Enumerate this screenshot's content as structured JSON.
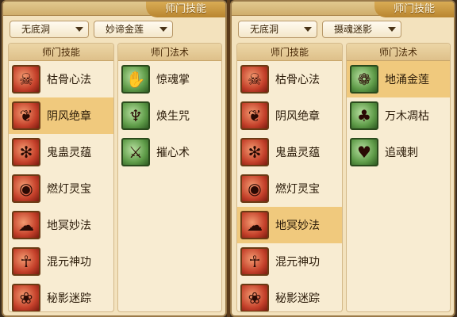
{
  "panels": [
    {
      "title": "师门技能",
      "dropdown_school": "无底洞",
      "dropdown_skill": "妙谛金莲",
      "skills_header": "师门技能",
      "spells_header": "师门法术",
      "skills": [
        {
          "label": "枯骨心法",
          "icon": "skull-meditation-icon",
          "selected": false
        },
        {
          "label": "阴风绝章",
          "icon": "wind-scroll-icon",
          "selected": true
        },
        {
          "label": "鬼蛊灵蕴",
          "icon": "demon-insect-icon",
          "selected": false
        },
        {
          "label": "燃灯灵宝",
          "icon": "lamp-coin-icon",
          "selected": false
        },
        {
          "label": "地冥妙法",
          "icon": "underworld-cloud-icon",
          "selected": false
        },
        {
          "label": "混元神功",
          "icon": "chaos-figure-icon",
          "selected": false
        },
        {
          "label": "秘影迷踪",
          "icon": "shadow-swirl-icon",
          "selected": false
        }
      ],
      "spells": [
        {
          "label": "惊魂掌",
          "icon": "palm-icon"
        },
        {
          "label": "焕生咒",
          "icon": "rebirth-figure-icon"
        },
        {
          "label": "摧心术",
          "icon": "heart-crush-icon"
        }
      ]
    },
    {
      "title": "师门技能",
      "dropdown_school": "无底洞",
      "dropdown_skill": "摄魂迷影",
      "skills_header": "师门技能",
      "spells_header": "师门法术",
      "skills": [
        {
          "label": "枯骨心法",
          "icon": "skull-meditation-icon",
          "selected": false
        },
        {
          "label": "阴风绝章",
          "icon": "wind-scroll-icon",
          "selected": false
        },
        {
          "label": "鬼蛊灵蕴",
          "icon": "demon-insect-icon",
          "selected": false
        },
        {
          "label": "燃灯灵宝",
          "icon": "lamp-coin-icon",
          "selected": false
        },
        {
          "label": "地冥妙法",
          "icon": "underworld-cloud-icon",
          "selected": true
        },
        {
          "label": "混元神功",
          "icon": "chaos-figure-icon",
          "selected": false
        },
        {
          "label": "秘影迷踪",
          "icon": "shadow-swirl-icon",
          "selected": false
        }
      ],
      "spells": [
        {
          "label": "地涌金莲",
          "icon": "lotus-icon",
          "selected": true
        },
        {
          "label": "万木凋枯",
          "icon": "withered-tree-icon",
          "selected": false
        },
        {
          "label": "追魂刺",
          "icon": "heart-thorn-icon",
          "selected": false
        }
      ]
    }
  ]
}
